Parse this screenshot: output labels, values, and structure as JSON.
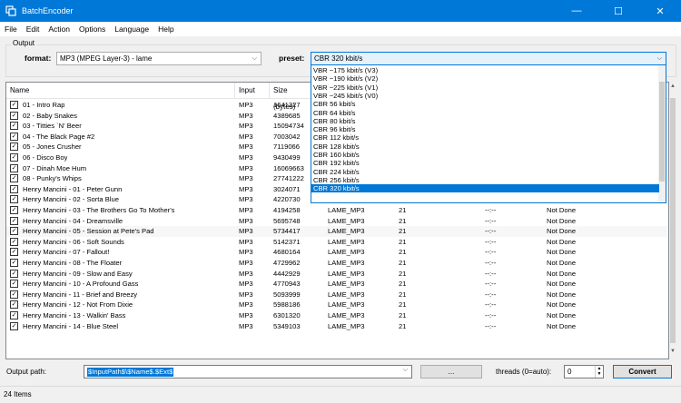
{
  "window": {
    "title": "BatchEncoder",
    "controls": {
      "minimize": "—",
      "maximize": "☐",
      "close": "✕"
    }
  },
  "menu": [
    "File",
    "Edit",
    "Action",
    "Options",
    "Language",
    "Help"
  ],
  "output_group": {
    "label": "Output",
    "format_label": "format:",
    "format_value": "MP3 (MPEG Layer-3) - lame",
    "preset_label": "preset:",
    "preset_value": "CBR 320 kbit/s"
  },
  "list": {
    "columns": [
      "Name",
      "Input",
      "Size (bytes)"
    ],
    "rows": [
      {
        "name": "01 - Intro Rap",
        "input": "MP3",
        "size": "1641327",
        "col4": "",
        "col5": "",
        "col6": "",
        "col7": ""
      },
      {
        "name": "02 - Baby Snakes",
        "input": "MP3",
        "size": "4389685",
        "col4": "",
        "col5": "",
        "col6": "",
        "col7": ""
      },
      {
        "name": "03 - Titties `N' Beer",
        "input": "MP3",
        "size": "15094734",
        "col4": "",
        "col5": "",
        "col6": "",
        "col7": ""
      },
      {
        "name": "04 - The Black Page #2",
        "input": "MP3",
        "size": "7003042",
        "col4": "",
        "col5": "",
        "col6": "",
        "col7": ""
      },
      {
        "name": "05 - Jones Crusher",
        "input": "MP3",
        "size": "7119066",
        "col4": "",
        "col5": "",
        "col6": "",
        "col7": ""
      },
      {
        "name": "06 - Disco Boy",
        "input": "MP3",
        "size": "9430499",
        "col4": "",
        "col5": "",
        "col6": "",
        "col7": ""
      },
      {
        "name": "07 - Dinah Moe Hum",
        "input": "MP3",
        "size": "16069663",
        "col4": "",
        "col5": "",
        "col6": "",
        "col7": ""
      },
      {
        "name": "08 - Punky's Whips",
        "input": "MP3",
        "size": "27741222",
        "col4": "",
        "col5": "",
        "col6": "",
        "col7": ""
      },
      {
        "name": "Henry Mancini - 01 - Peter Gunn",
        "input": "MP3",
        "size": "3024071",
        "col4": "",
        "col5": "",
        "col6": "",
        "col7": ""
      },
      {
        "name": "Henry Mancini - 02 - Sorta Blue",
        "input": "MP3",
        "size": "4220730",
        "col4": "LAME_MP3",
        "col5": "21",
        "col6": "--:--",
        "col7": "Not Done"
      },
      {
        "name": "Henry Mancini - 03 - The Brothers Go To Mother's",
        "input": "MP3",
        "size": "4194258",
        "col4": "LAME_MP3",
        "col5": "21",
        "col6": "--:--",
        "col7": "Not Done"
      },
      {
        "name": "Henry Mancini - 04 - Dreamsville",
        "input": "MP3",
        "size": "5695748",
        "col4": "LAME_MP3",
        "col5": "21",
        "col6": "--:--",
        "col7": "Not Done"
      },
      {
        "name": "Henry Mancini - 05 - Session at Pete's Pad",
        "input": "MP3",
        "size": "5734417",
        "col4": "LAME_MP3",
        "col5": "21",
        "col6": "--:--",
        "col7": "Not Done"
      },
      {
        "name": "Henry Mancini - 06 - Soft Sounds",
        "input": "MP3",
        "size": "5142371",
        "col4": "LAME_MP3",
        "col5": "21",
        "col6": "--:--",
        "col7": "Not Done"
      },
      {
        "name": "Henry Mancini - 07 - Fallout!",
        "input": "MP3",
        "size": "4680164",
        "col4": "LAME_MP3",
        "col5": "21",
        "col6": "--:--",
        "col7": "Not Done"
      },
      {
        "name": "Henry Mancini - 08 - The Floater",
        "input": "MP3",
        "size": "4729962",
        "col4": "LAME_MP3",
        "col5": "21",
        "col6": "--:--",
        "col7": "Not Done"
      },
      {
        "name": "Henry Mancini - 09 - Slow and Easy",
        "input": "MP3",
        "size": "4442929",
        "col4": "LAME_MP3",
        "col5": "21",
        "col6": "--:--",
        "col7": "Not Done"
      },
      {
        "name": "Henry Mancini - 10 - A Profound Gass",
        "input": "MP3",
        "size": "4770943",
        "col4": "LAME_MP3",
        "col5": "21",
        "col6": "--:--",
        "col7": "Not Done"
      },
      {
        "name": "Henry Mancini - 11 - Brief and Breezy",
        "input": "MP3",
        "size": "5093999",
        "col4": "LAME_MP3",
        "col5": "21",
        "col6": "--:--",
        "col7": "Not Done"
      },
      {
        "name": "Henry Mancini - 12 - Not From Dixie",
        "input": "MP3",
        "size": "5988186",
        "col4": "LAME_MP3",
        "col5": "21",
        "col6": "--:--",
        "col7": "Not Done"
      },
      {
        "name": "Henry Mancini - 13 - Walkin' Bass",
        "input": "MP3",
        "size": "6301320",
        "col4": "LAME_MP3",
        "col5": "21",
        "col6": "--:--",
        "col7": "Not Done"
      },
      {
        "name": "Henry Mancini - 14 - Blue Steel",
        "input": "MP3",
        "size": "5349103",
        "col4": "LAME_MP3",
        "col5": "21",
        "col6": "--:--",
        "col7": "Not Done"
      }
    ]
  },
  "preset_dropdown": {
    "items": [
      "VBR ~175 kbit/s (V3)",
      "VBR ~190 kbit/s (V2)",
      "VBR ~225 kbit/s (V1)",
      "VBR ~245 kbit/s (V0)",
      "CBR 56 kbit/s",
      "CBR 64 kbit/s",
      "CBR 80 kbit/s",
      "CBR 96 kbit/s",
      "CBR 112 kbit/s",
      "CBR 128 kbit/s",
      "CBR 160 kbit/s",
      "CBR 192 kbit/s",
      "CBR 224 kbit/s",
      "CBR 256 kbit/s",
      "CBR 320 kbit/s"
    ],
    "selected_index": 14
  },
  "bottom": {
    "output_path_label": "Output path:",
    "output_path_value": "$InputPath$\\$Name$.$Ext$",
    "browse_label": "...",
    "threads_label": "threads (0=auto):",
    "threads_value": "0",
    "convert_label": "Convert"
  },
  "status": {
    "text": "24 Items"
  }
}
